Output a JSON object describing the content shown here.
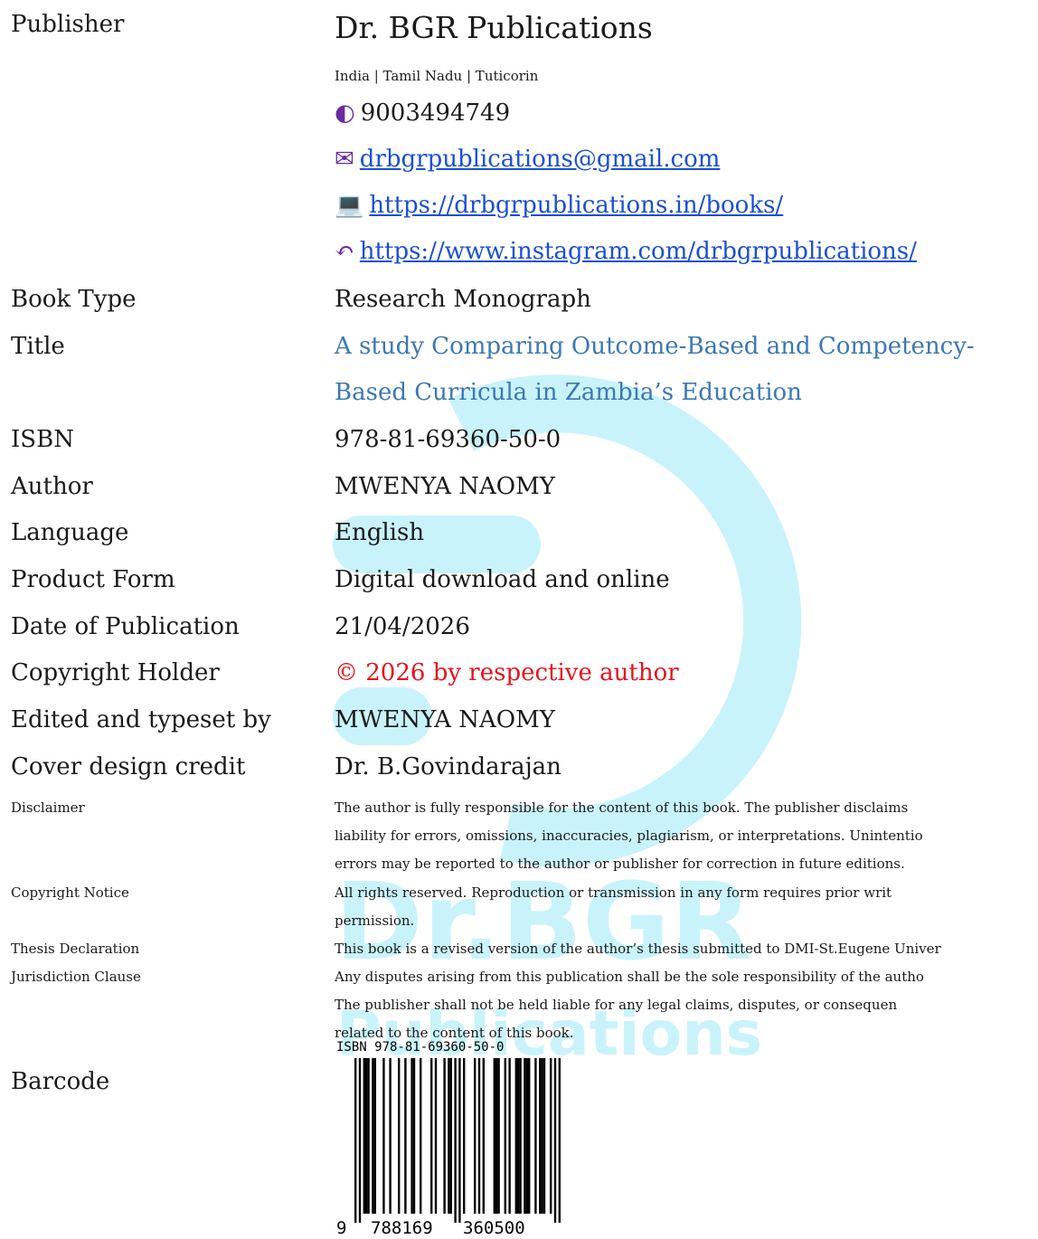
{
  "publisher": {
    "label": "Publisher",
    "name": "Dr. BGR Publications",
    "location": "India | Tamil Nadu | Tuticorin",
    "phone": "9003494749",
    "email": "drbgrpublications@gmail.com",
    "website": "https://drbgrpublications.in/books/",
    "instagram": "https://www.instagram.com/drbgrpublications/",
    "icons": [
      "phone-icon",
      "envelope-icon",
      "laptop-icon",
      "mouse-icon"
    ]
  },
  "details": [
    {
      "label": "Book Type",
      "value": "Research Monograph"
    },
    {
      "label": "Title",
      "value": "A study Comparing Outcome-Based and Competency-",
      "value2": "Based Curricula in Zambia’s Education"
    },
    {
      "label": "ISBN",
      "value": "978-81-69360-50-0"
    },
    {
      "label": "Author",
      "value": "MWENYA NAOMY"
    },
    {
      "label": "Language",
      "value": "English"
    },
    {
      "label": "Product Form",
      "value": "Digital download and online"
    },
    {
      "label": "Date of Publication",
      "value": "21/04/2026"
    },
    {
      "label": "Copyright Holder",
      "value": "© 2026 by respective author"
    },
    {
      "label": "Edited and typeset by",
      "value": "MWENYA NAOMY"
    },
    {
      "label": "Cover design credit",
      "value": "Dr. B.Govindarajan"
    }
  ],
  "notices": [
    {
      "label": "Disclaimer",
      "lines": [
        "The author is fully responsible for the content of this book. The publisher disclaims",
        "liability for errors, omissions, inaccuracies, plagiarism, or interpretations. Unintentio",
        "errors may be reported to the author or publisher for correction in future editions."
      ]
    },
    {
      "label": "Copyright Notice",
      "lines": [
        "All rights reserved. Reproduction or transmission in any form requires prior writ",
        "permission."
      ]
    },
    {
      "label": "Thesis Declaration",
      "lines": [
        "This book is a revised version of the author’s thesis submitted to DMI-St.Eugene Univer"
      ]
    },
    {
      "label": "Jurisdiction Clause",
      "lines": [
        "Any disputes arising from this publication shall be the sole responsibility of the autho",
        "The publisher shall not be held liable for any legal claims, disputes, or consequen",
        "related to the content of this book."
      ]
    }
  ],
  "barcode": {
    "label": "Barcode",
    "isbn_text": "ISBN 978-81-69360-50-0",
    "digits_first": "9",
    "digits_left": "788169",
    "digits_right": "360500"
  },
  "watermark": {
    "line1": "Dr.BGR",
    "line2": "Publications",
    "color": "#c9f3fb"
  },
  "colors": {
    "title": "#3c78b4",
    "copyright": "#e8121c",
    "link": "#1b4fd6",
    "icon": "#6b2aa0"
  }
}
